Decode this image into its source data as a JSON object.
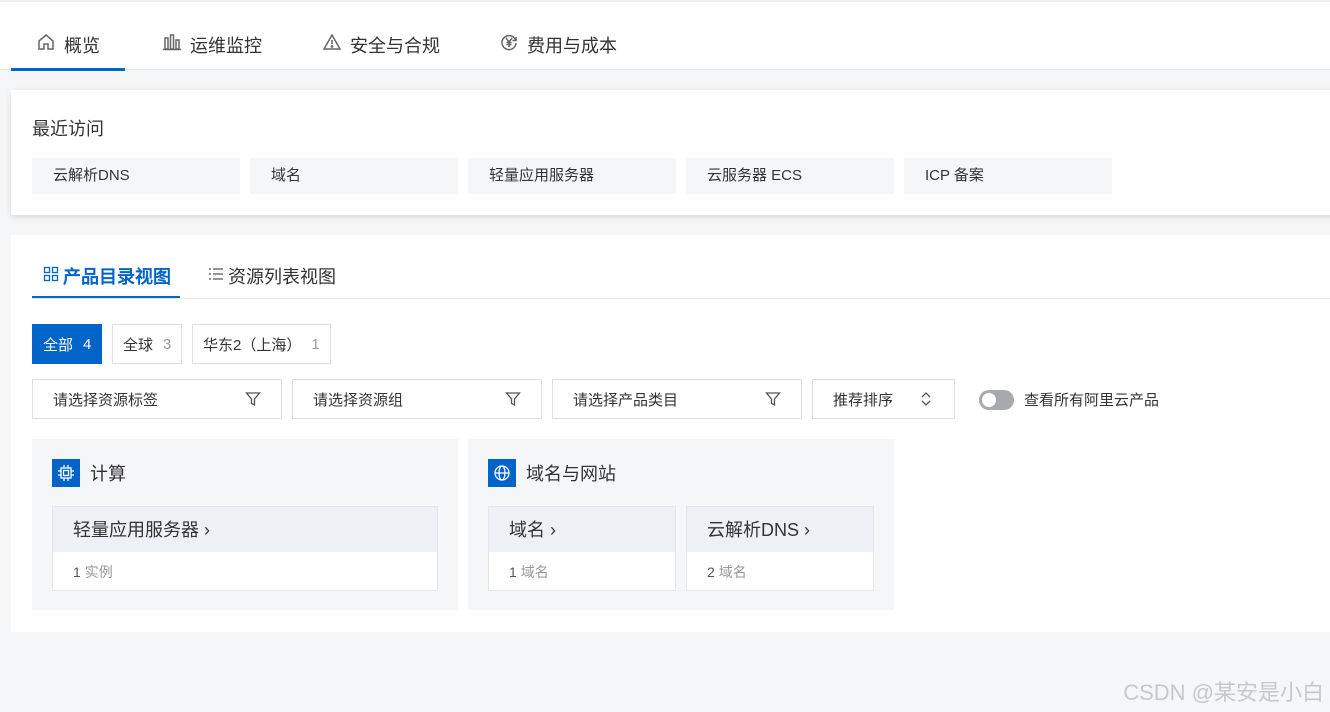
{
  "top_tabs": [
    {
      "label": "概览",
      "icon": "home-icon",
      "active": true
    },
    {
      "label": "运维监控",
      "icon": "bar-chart-icon",
      "active": false
    },
    {
      "label": "安全与合规",
      "icon": "warning-icon",
      "active": false
    },
    {
      "label": "费用与成本",
      "icon": "yuan-icon",
      "active": false
    }
  ],
  "recent": {
    "title": "最近访问",
    "items": [
      "云解析DNS",
      "域名",
      "轻量应用服务器",
      "云服务器 ECS",
      "ICP 备案"
    ]
  },
  "view_tabs": [
    {
      "label": "产品目录视图",
      "icon": "grid-icon",
      "active": true
    },
    {
      "label": "资源列表视图",
      "icon": "list-icon",
      "active": false
    }
  ],
  "regions": [
    {
      "label": "全部",
      "count": "4",
      "active": true
    },
    {
      "label": "全球",
      "count": "3",
      "active": false
    },
    {
      "label": "华东2（上海）",
      "count": "1",
      "active": false
    }
  ],
  "filters": {
    "tag_placeholder": "请选择资源标签",
    "group_placeholder": "请选择资源组",
    "category_placeholder": "请选择产品类目",
    "sort_label": "推荐排序"
  },
  "toggle": {
    "label": "查看所有阿里云产品",
    "on": false
  },
  "categories": [
    {
      "title": "计算",
      "icon": "cpu-icon",
      "products": [
        {
          "name": "轻量应用服务器 ›",
          "count": "1",
          "unit": "实例"
        }
      ]
    },
    {
      "title": "域名与网站",
      "icon": "globe-icon",
      "products": [
        {
          "name": "域名 ›",
          "count": "1",
          "unit": "域名"
        },
        {
          "name": "云解析DNS ›",
          "count": "2",
          "unit": "域名"
        }
      ]
    }
  ],
  "watermark": "CSDN @某安是小白",
  "colors": {
    "accent": "#0064c8",
    "bg": "#f5f6f8"
  }
}
